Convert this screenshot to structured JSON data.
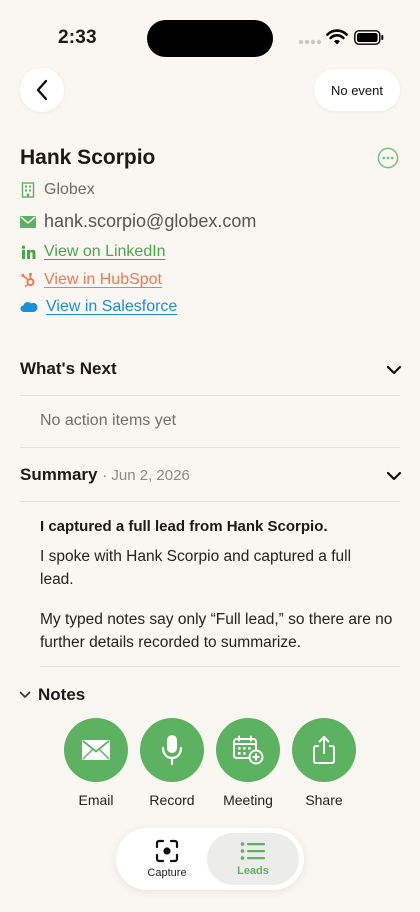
{
  "status": {
    "time": "2:33"
  },
  "header": {
    "no_event_label": "No event"
  },
  "contact": {
    "name": "Hank Scorpio",
    "company": "Globex",
    "email": "hank.scorpio@globex.com",
    "linkedin_label": "View on LinkedIn",
    "hubspot_label": "View in HubSpot",
    "salesforce_label": "View in Salesforce"
  },
  "whats_next": {
    "title": "What's Next",
    "empty_text": "No action items yet"
  },
  "summary": {
    "title": "Summary",
    "date": "· Jun 2, 2026",
    "heading": "I captured a full lead from Hank Scorpio.",
    "paragraph1": "I spoke with Hank Scorpio and captured a full lead.",
    "paragraph2": "My typed notes say only “Full lead,” so there are no further details recorded to summarize."
  },
  "notes": {
    "title": "Notes"
  },
  "actions": [
    {
      "label": "Email",
      "icon": "envelope-icon"
    },
    {
      "label": "Record",
      "icon": "microphone-icon"
    },
    {
      "label": "Meeting",
      "icon": "calendar-add-icon"
    },
    {
      "label": "Share",
      "icon": "share-icon"
    }
  ],
  "tabbar": {
    "tabs": [
      {
        "label": "Capture",
        "icon": "capture-icon",
        "selected": false
      },
      {
        "label": "Leads",
        "icon": "list-icon",
        "selected": true
      }
    ]
  },
  "colors": {
    "accent_green": "#5db262",
    "linkedin_green": "#4aa54d",
    "hubspot_orange": "#f07854",
    "salesforce_blue": "#1a8ed6",
    "background": "#faf7f2"
  }
}
